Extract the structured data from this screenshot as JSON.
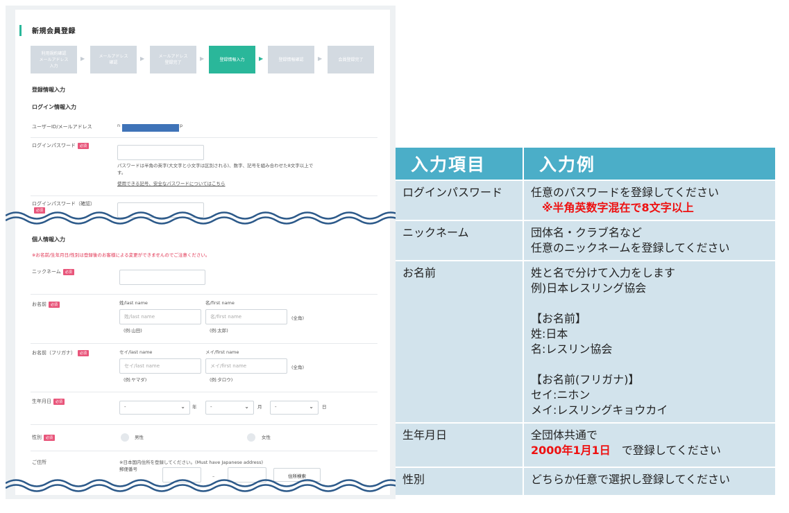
{
  "form": {
    "title": "新規会員登録",
    "steps": [
      {
        "label": "利用規約確認\nメールアドレス\n入力",
        "active": false
      },
      {
        "label": "メールアドレス\n確認",
        "active": false
      },
      {
        "label": "メールアドレス\n登録完了",
        "active": false
      },
      {
        "label": "登録情報入力",
        "active": true
      },
      {
        "label": "登録情報確認",
        "active": false
      },
      {
        "label": "会員登録完了",
        "active": false
      }
    ],
    "section_registration": "登録情報入力",
    "section_login": "ログイン情報入力",
    "userid_label": "ユーザーID/メールアドレス",
    "userid_prefix": "n",
    "userid_suffix": "p",
    "password_label": "ログインパスワード",
    "required_badge": "必須",
    "password_help": "パスワードは半角の英字(大文字と小文字は区別される)、数字、記号を組み合わせた8文字以上で\nす。",
    "password_link": "使用できる記号、安全なパスワードについてはこちら",
    "password_confirm_label": "ログインパスワード（確認）",
    "section_personal": "個人情報入力",
    "personal_notice": "※お名前/生年月日/性別は登録後のお客様による変更ができませんのでご注意ください。",
    "nickname_label": "ニックネーム",
    "name_label": "お名前",
    "last_name_header": "姓/last name",
    "first_name_header": "名/first name",
    "last_name_placeholder": "姓/last name",
    "first_name_placeholder": "名/first name",
    "fullwidth_note": "(全角)",
    "last_name_example": "(例:山田)",
    "first_name_example": "(例:太郎)",
    "kana_label": "お名前（フリガナ）",
    "kana_last_header": "セイ/last name",
    "kana_first_header": "メイ/first name",
    "kana_last_placeholder": "セイ/last name",
    "kana_first_placeholder": "メイ/first name",
    "kana_last_example": "(例:ヤマダ)",
    "kana_first_example": "(例:タロウ)",
    "birthdate_label": "生年月日",
    "select_default": "-",
    "year_unit": "年",
    "month_unit": "月",
    "day_unit": "日",
    "gender_label": "性別",
    "male": "男性",
    "female": "女性",
    "address_label": "ご住所",
    "address_note": "※日本国内住所を登録してください。(Must have Japanese address)",
    "postal_label": "郵便番号",
    "postal_dash": "–",
    "address_search": "住所検索"
  },
  "table": {
    "header_item": "入力項目",
    "header_example": "入力例",
    "rows": [
      {
        "item": "ログインパスワード",
        "example_1": "任意のパスワードを登録してください",
        "example_2": "　※半角英数字混在で8文字以上"
      },
      {
        "item": "ニックネーム",
        "example_1": "団体名・クラブ名など",
        "example_2": "任意のニックネームを登録してください"
      },
      {
        "item": "お名前",
        "lines": [
          "姓と名で分けて入力をします",
          "例)日本レスリング協会",
          " ",
          "【お名前】",
          "姓:日本",
          "名:レスリン協会",
          " ",
          "【お名前(フリガナ)】",
          "セイ:ニホン",
          "メイ:レスリングキョウカイ"
        ]
      },
      {
        "item": "生年月日",
        "example_1": "全団体共通で",
        "example_2_red": "2000年1月1日",
        "example_2_rest": "　で登録してください"
      },
      {
        "item": "性別",
        "example_1": "どちらか任意で選択し登録してください"
      }
    ]
  },
  "colors": {
    "accent": "#2ab79a",
    "table_header": "#4baec8",
    "table_cell": "#d2e3ec",
    "required": "#e8557a",
    "emphasis": "#ee1111"
  }
}
